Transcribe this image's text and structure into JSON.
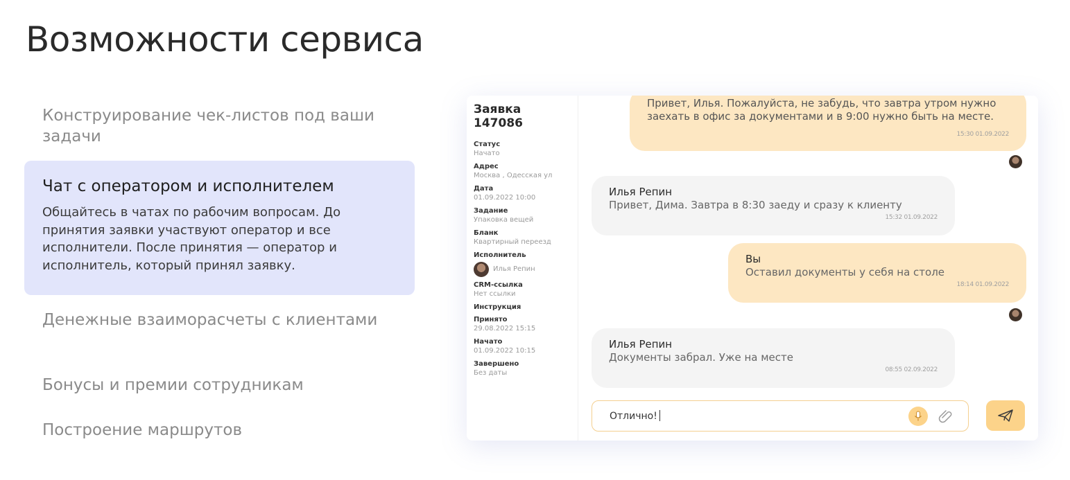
{
  "page": {
    "title": "Возможности сервиса"
  },
  "features": [
    {
      "label": "Конструирование чек-листов под ваши задачи"
    },
    {
      "label": "Чат с оператором и исполнителем",
      "description": "Общайтесь в чатах по рабочим вопросам. До принятия заявки участвуют оператор и все исполнители. После принятия — оператор и исполнитель, который принял заявку."
    },
    {
      "label": "Денежные взаиморасчеты с клиентами"
    },
    {
      "label": "Бонусы и премии сотрудникам"
    },
    {
      "label": "Построение маршрутов"
    }
  ],
  "order": {
    "title": "Заявка 147086",
    "fields": [
      {
        "label": "Статус",
        "value": "Начато"
      },
      {
        "label": "Адрес",
        "value": "Москва , Одесская ул"
      },
      {
        "label": "Дата",
        "value": "01.09.2022 10:00"
      },
      {
        "label": "Задание",
        "value": "Упаковка вещей"
      },
      {
        "label": "Бланк",
        "value": "Квартирный переезд"
      },
      {
        "label": "Исполнитель",
        "value": "Илья Репин"
      },
      {
        "label": "CRM-ссылка",
        "value": "Нет ссылки"
      },
      {
        "label": "Инструкция",
        "value": ""
      },
      {
        "label": "Принято",
        "value": "29.08.2022 15:15"
      },
      {
        "label": "Начато",
        "value": "01.09.2022 10:15"
      },
      {
        "label": "Завершено",
        "value": "Без даты"
      }
    ]
  },
  "chat": {
    "messages": [
      {
        "author": "",
        "text": "Привет, Илья. Пожалуйста, не забудь, что завтра утром нужно заехать в офис за документами и в 9:00 нужно быть на месте.",
        "time": "15:30 01.09.2022"
      },
      {
        "author": "Илья Репин",
        "text": "Привет, Дима. Завтра в 8:30 заеду и сразу к клиенту",
        "time": "15:32 01.09.2022"
      },
      {
        "author": "Вы",
        "text": "Оставил документы у себя на столе",
        "time": "18:14 01.09.2022"
      },
      {
        "author": "Илья Репин",
        "text": "Документы забрал. Уже на месте",
        "time": "08:55 02.09.2022"
      }
    ],
    "input": {
      "value": "Отлично!"
    }
  },
  "icons": {
    "mic": "microphone-icon",
    "attach": "paperclip-icon",
    "send": "paper-plane-icon"
  },
  "colors": {
    "accent": "#fcd38a",
    "outgoing_bubble": "#fde7c2",
    "incoming_bubble": "#f4f4f4",
    "active_feature_bg": "#e2e5fb"
  }
}
